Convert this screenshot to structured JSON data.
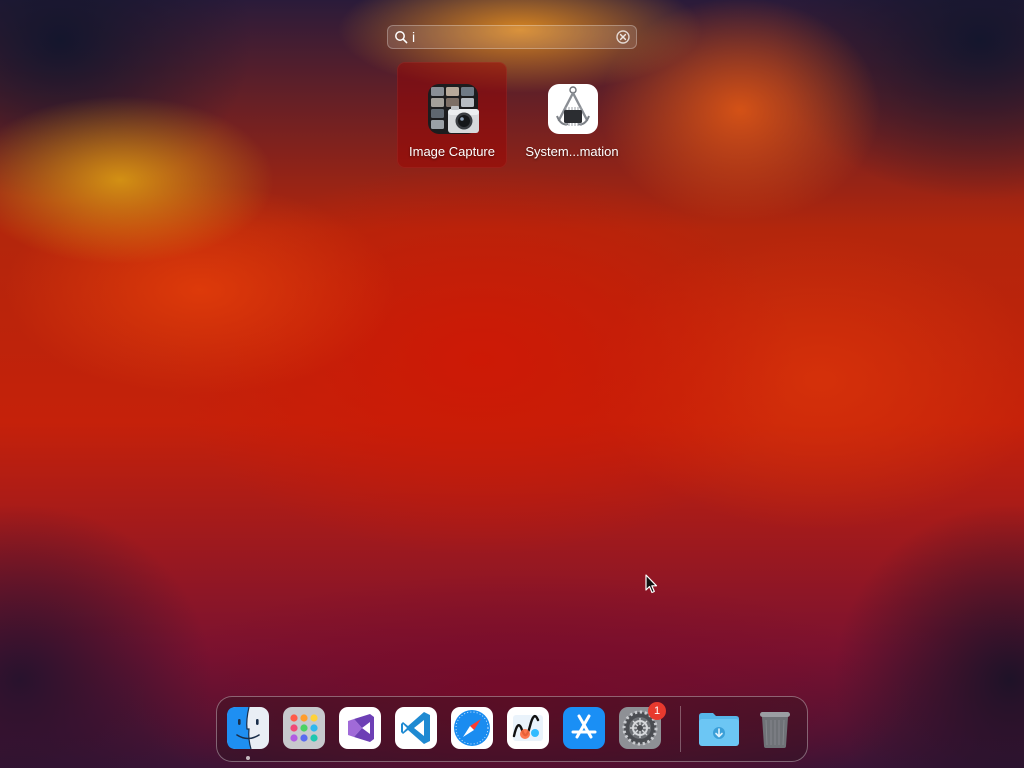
{
  "search": {
    "value": "i",
    "placeholder": ""
  },
  "results": [
    {
      "label": "Image Capture",
      "icon": "image-capture-icon",
      "selected": true
    },
    {
      "label": "System...mation",
      "icon": "system-information-icon",
      "selected": false
    }
  ],
  "dock": {
    "apps": [
      {
        "name": "Finder",
        "icon": "finder-icon",
        "running": true
      },
      {
        "name": "Launchpad",
        "icon": "launchpad-icon"
      },
      {
        "name": "Visual Studio",
        "icon": "visual-studio-icon"
      },
      {
        "name": "Visual Studio Code",
        "icon": "vscode-icon"
      },
      {
        "name": "Safari",
        "icon": "safari-icon"
      },
      {
        "name": "Freeform",
        "icon": "freeform-icon"
      },
      {
        "name": "App Store",
        "icon": "app-store-icon"
      },
      {
        "name": "System Settings",
        "icon": "system-settings-icon",
        "badge": "1"
      }
    ],
    "others": [
      {
        "name": "Downloads",
        "icon": "downloads-folder-icon"
      },
      {
        "name": "Trash",
        "icon": "trash-icon"
      }
    ]
  },
  "colors": {
    "selected_bg": "#a00000",
    "badge": "#e8392e"
  }
}
